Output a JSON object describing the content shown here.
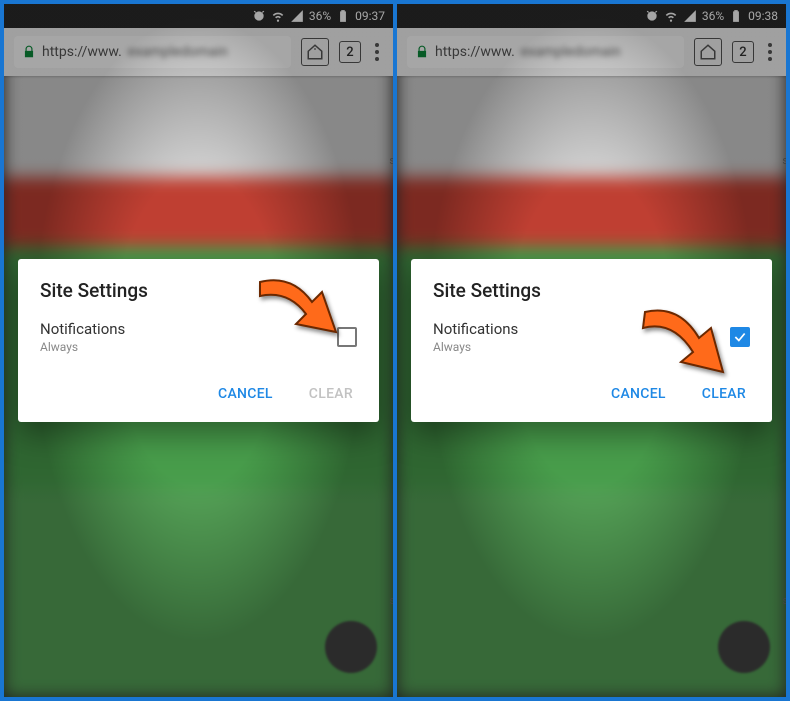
{
  "phones": {
    "left": {
      "status": {
        "time": "09:37",
        "battery": "36%"
      },
      "url_prefix": "https://www.",
      "tab_count": "2",
      "dialog": {
        "title": "Site Settings",
        "item_title": "Notifications",
        "item_sub": "Always",
        "checked": false,
        "cancel": "CANCEL",
        "clear": "CLEAR",
        "clear_enabled": false
      }
    },
    "right": {
      "status": {
        "time": "09:38",
        "battery": "36%"
      },
      "url_prefix": "https://www.",
      "tab_count": "2",
      "dialog": {
        "title": "Site Settings",
        "item_title": "Notifications",
        "item_sub": "Always",
        "checked": true,
        "cancel": "CANCEL",
        "clear": "CLEAR",
        "clear_enabled": true
      }
    }
  },
  "colors": {
    "accent": "#1e88e5",
    "arrow": "#ff6a1a"
  }
}
